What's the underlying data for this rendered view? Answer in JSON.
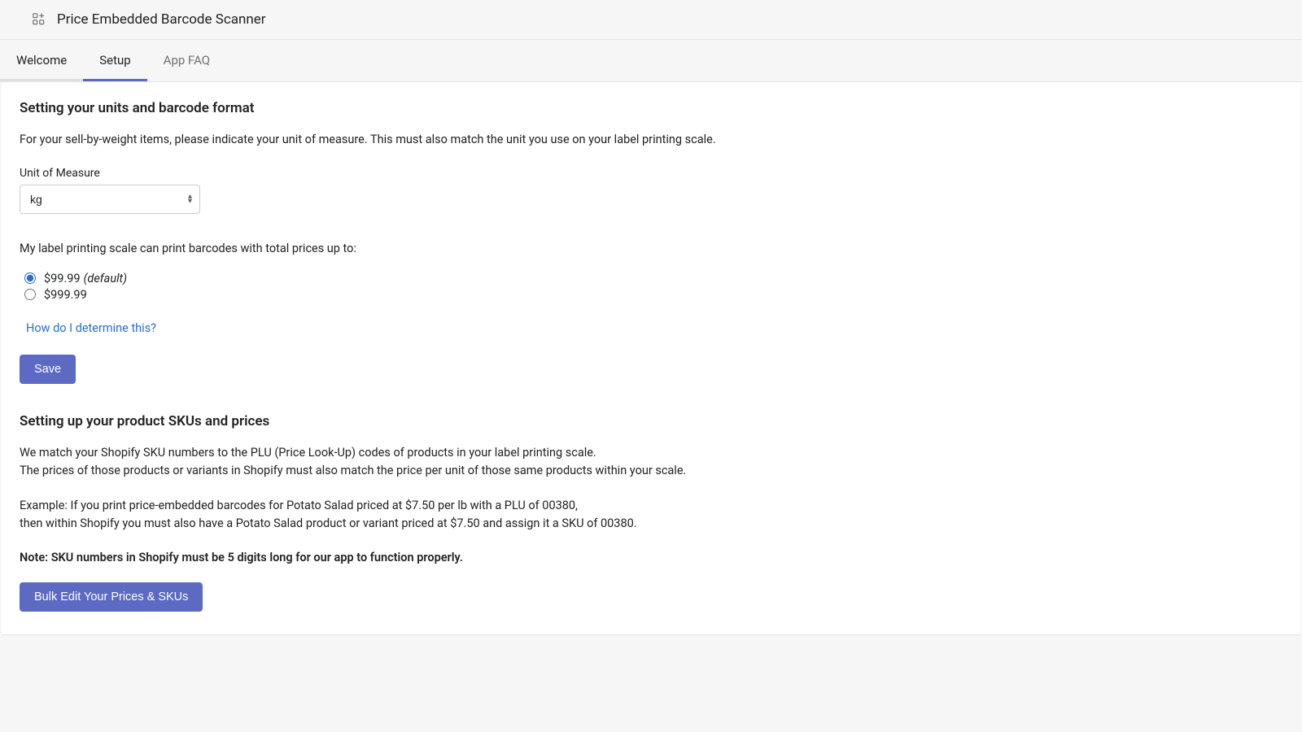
{
  "header": {
    "app_title": "Price Embedded Barcode Scanner"
  },
  "tabs": {
    "welcome": "Welcome",
    "setup": "Setup",
    "faq": "App FAQ"
  },
  "section1": {
    "heading": "Setting your units and barcode format",
    "desc": "For your sell-by-weight items, please indicate your unit of measure. This must also match the unit you use on your label printing scale.",
    "unit_label": "Unit of Measure",
    "unit_value": "kg",
    "radio_question": "My label printing scale can print barcodes with total prices up to:",
    "radio_options": {
      "opt1_label": "$99.99",
      "opt1_suffix": "(default)",
      "opt2_label": "$999.99"
    },
    "help_link": "How do I determine this?",
    "save_label": "Save"
  },
  "section2": {
    "heading": "Setting up your product SKUs and prices",
    "para1_line1": "We match your Shopify SKU numbers to the PLU (Price Look-Up) codes of products in your label printing scale.",
    "para1_line2": "The prices of those products or variants in Shopify must also match the price per unit of those same products within your scale.",
    "para2_line1": "Example: If you print price-embedded barcodes for Potato Salad priced at $7.50 per lb with a PLU of 00380,",
    "para2_line2": "then within Shopify you must also have a Potato Salad product or variant priced at $7.50 and assign it a SKU of 00380.",
    "note": "Note: SKU numbers in Shopify must be 5 digits long for our app to function properly.",
    "bulk_edit_label": "Bulk Edit Your Prices & SKUs"
  }
}
